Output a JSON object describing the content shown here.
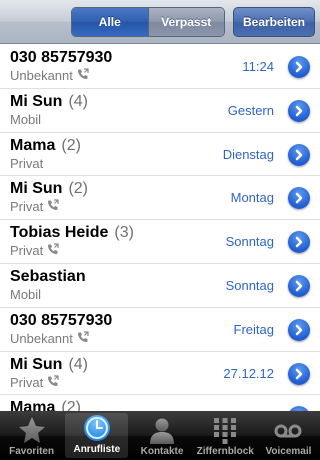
{
  "navbar": {
    "segments": [
      "Alle",
      "Verpasst"
    ],
    "selected_segment": "Alle",
    "edit_label": "Bearbeiten"
  },
  "calls": [
    {
      "name": "030 85757930",
      "count": "",
      "type": "Unbekannt",
      "outgoing": true,
      "time": "11:24"
    },
    {
      "name": "Mi Sun",
      "count": "(4)",
      "type": "Mobil",
      "outgoing": false,
      "time": "Gestern"
    },
    {
      "name": "Mama",
      "count": "(2)",
      "type": "Privat",
      "outgoing": false,
      "time": "Dienstag"
    },
    {
      "name": "Mi Sun",
      "count": "(2)",
      "type": "Privat",
      "outgoing": true,
      "time": "Montag"
    },
    {
      "name": "Tobias Heide",
      "count": "(3)",
      "type": "Privat",
      "outgoing": true,
      "time": "Sonntag"
    },
    {
      "name": "Sebastian",
      "count": "",
      "type": "Mobil",
      "outgoing": false,
      "time": "Sonntag"
    },
    {
      "name": "030 85757930",
      "count": "",
      "type": "Unbekannt",
      "outgoing": true,
      "time": "Freitag"
    },
    {
      "name": "Mi Sun",
      "count": "(4)",
      "type": "Privat",
      "outgoing": true,
      "time": "27.12.12"
    },
    {
      "name": "Mama",
      "count": "(2)",
      "type": "",
      "outgoing": false,
      "time": ""
    }
  ],
  "tabs": [
    {
      "label": "Favoriten",
      "icon": "star-icon",
      "selected": false
    },
    {
      "label": "Anrufliste",
      "icon": "clock-icon",
      "selected": true
    },
    {
      "label": "Kontakte",
      "icon": "contact-icon",
      "selected": false
    },
    {
      "label": "Ziffernblock",
      "icon": "keypad-icon",
      "selected": false
    },
    {
      "label": "Voicemail",
      "icon": "voicemail-icon",
      "selected": false
    }
  ],
  "colors": {
    "time_text": "#2f66c6",
    "disclosure": "#1f5cd0",
    "navbar": "#b7bfcb"
  }
}
